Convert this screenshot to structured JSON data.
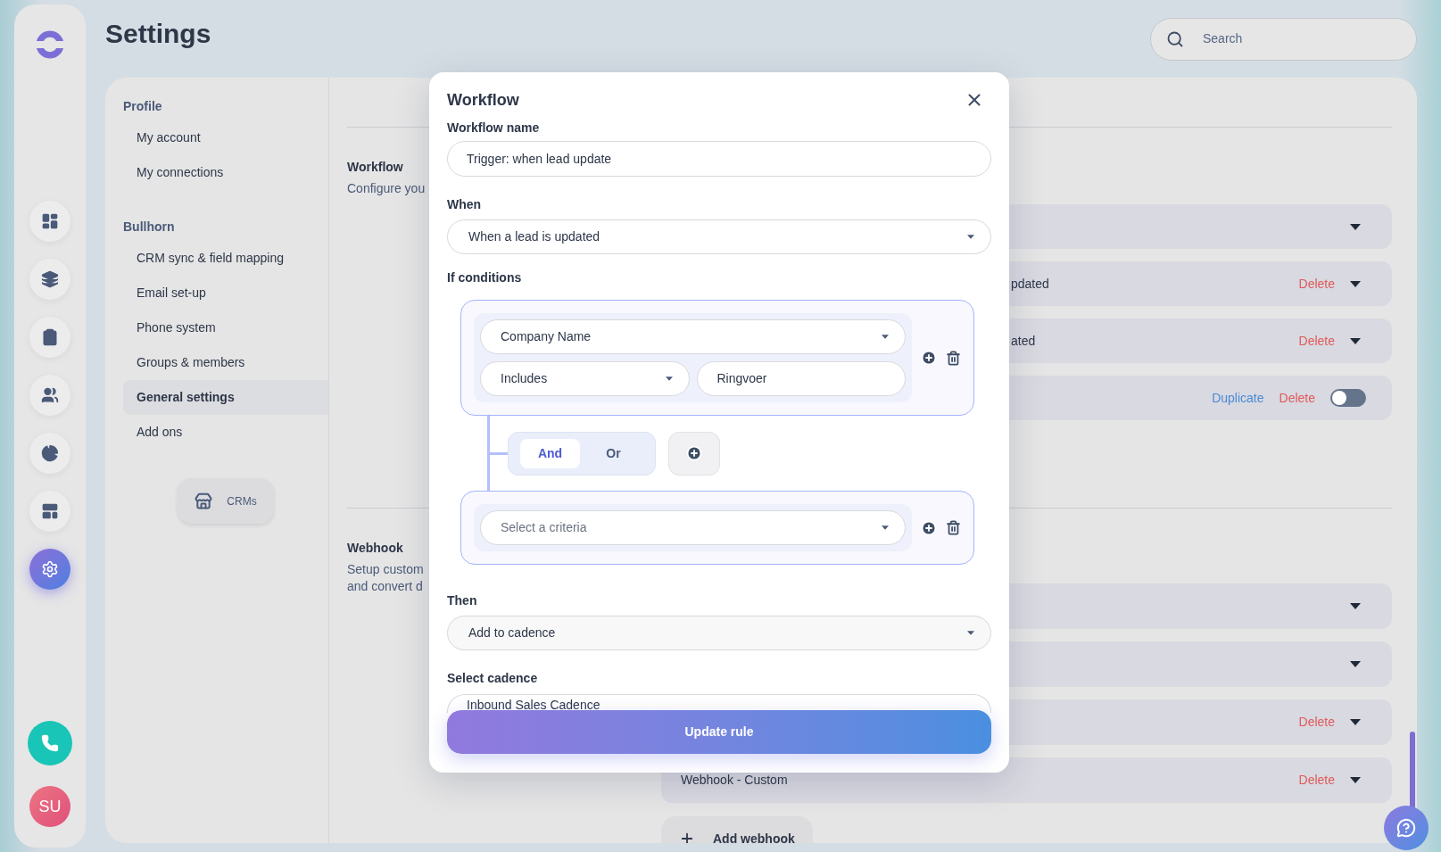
{
  "rail": {
    "items": [
      {
        "selected": false
      },
      {
        "selected": false
      },
      {
        "selected": false
      },
      {
        "selected": false
      },
      {
        "selected": false
      },
      {
        "selected": false
      },
      {
        "selected": true
      }
    ],
    "avatar": "SU"
  },
  "page_title": "Settings",
  "search": {
    "placeholder": "Search"
  },
  "settings_nav": {
    "sections": [
      {
        "heading": "Profile",
        "items": [
          {
            "label": "My account",
            "selected": false
          },
          {
            "label": "My connections",
            "selected": false
          }
        ]
      },
      {
        "heading": "Bullhorn",
        "items": [
          {
            "label": "CRM sync & field mapping",
            "selected": false
          },
          {
            "label": "Email set-up",
            "selected": false
          },
          {
            "label": "Phone system",
            "selected": false
          },
          {
            "label": "Groups & members",
            "selected": false
          },
          {
            "label": "General settings",
            "selected": true
          },
          {
            "label": "Add ons",
            "selected": false
          }
        ]
      }
    ],
    "crm_button": "CRMs"
  },
  "sections": [
    {
      "title": "Workflow",
      "description": [
        "Configure you"
      ],
      "rows": [
        {
          "kind": "dropdown"
        },
        {
          "kind": "dropdown",
          "text": "pdated",
          "partly_hidden": true,
          "delete": "Delete"
        },
        {
          "kind": "dropdown",
          "text": "ated",
          "partly_hidden": true,
          "delete": "Delete"
        },
        {
          "kind": "toggle",
          "duplicate": "Duplicate",
          "delete": "Delete",
          "on": false
        }
      ]
    },
    {
      "title": "Webhook",
      "description": [
        "Setup custom",
        "and convert d"
      ],
      "rows": [
        {
          "kind": "dropdown"
        },
        {
          "kind": "dropdown"
        },
        {
          "kind": "dropdown",
          "delete": "Delete"
        },
        {
          "kind": "dropdown",
          "text": "Webhook - Custom",
          "partly_hidden": false,
          "delete": "Delete"
        }
      ],
      "add_button": "Add webhook"
    }
  ],
  "modal": {
    "title": "Workflow",
    "name_label": "Workflow name",
    "name_value": "Trigger: when lead update",
    "when_label": "When",
    "when_value": "When a lead is updated",
    "conditions_label": "If conditions",
    "groups": [
      {
        "rows": [
          [
            {
              "kind": "select",
              "value": "Company Name"
            }
          ],
          [
            {
              "kind": "select",
              "value": "Includes"
            },
            {
              "kind": "input",
              "value": "Ringvoer"
            }
          ]
        ]
      },
      {
        "rows": [
          [
            {
              "kind": "select",
              "placeholder": "Select a criteria"
            }
          ]
        ]
      }
    ],
    "operator": [
      {
        "label": "And",
        "selected": true
      },
      {
        "label": "Or",
        "selected": false
      }
    ],
    "then_label": "Then",
    "then_value": "Add to cadence",
    "cadence_label": "Select cadence",
    "cadence_value": "Inbound Sales Cadence",
    "submit": "Update rule"
  }
}
